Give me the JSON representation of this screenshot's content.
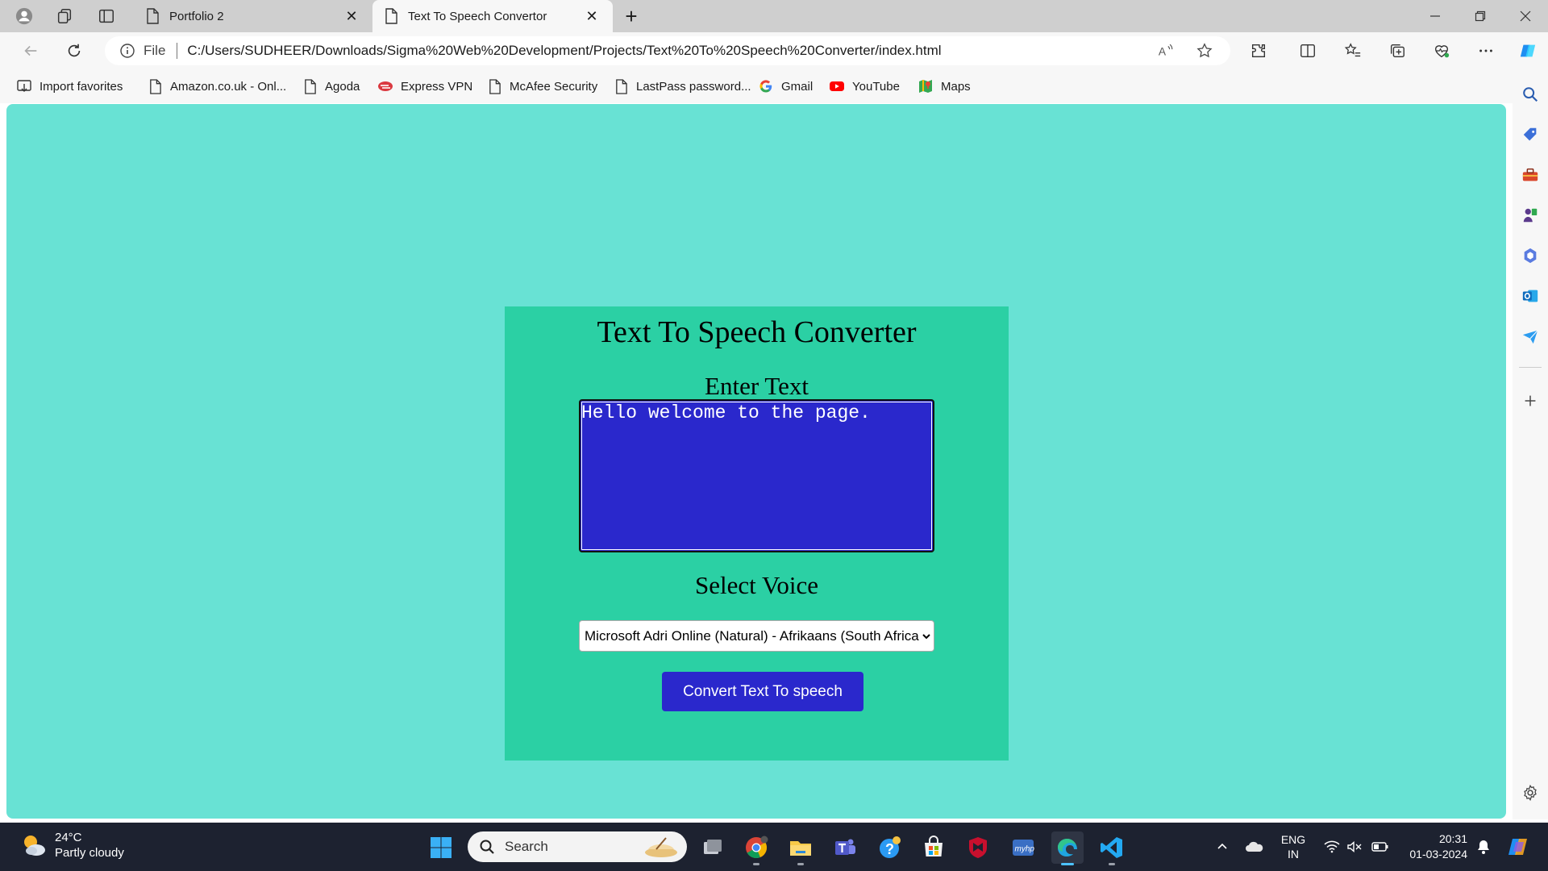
{
  "browser": {
    "tabs": [
      {
        "title": "Portfolio 2"
      },
      {
        "title": "Text To Speech Convertor"
      }
    ],
    "close_glyph": "✕",
    "newtab_glyph": "+",
    "address": {
      "scheme": "File",
      "url": "C:/Users/SUDHEER/Downloads/Sigma%20Web%20Development/Projects/Text%20To%20Speech%20Converter/index.html"
    },
    "favorites": [
      {
        "label": "Import favorites",
        "icon": "import-icon"
      },
      {
        "label": "Amazon.co.uk - Onl...",
        "icon": "page-icon"
      },
      {
        "label": "Agoda",
        "icon": "page-icon"
      },
      {
        "label": "Express VPN",
        "icon": "expressvpn-icon"
      },
      {
        "label": "McAfee Security",
        "icon": "page-icon"
      },
      {
        "label": "LastPass password...",
        "icon": "page-icon"
      },
      {
        "label": "Gmail",
        "icon": "google-icon"
      },
      {
        "label": "YouTube",
        "icon": "youtube-icon"
      },
      {
        "label": "Maps",
        "icon": "maps-icon"
      }
    ]
  },
  "app": {
    "title": "Text To Speech Converter",
    "enter_label": "Enter Text",
    "text_value": "Hello welcome to the page.",
    "voice_label": "Select Voice",
    "voice_selected": "Microsoft Adri Online (Natural) - Afrikaans (South Africa)",
    "convert_label": "Convert Text To speech"
  },
  "taskbar": {
    "weather": {
      "temp": "24°C",
      "condition": "Partly cloudy"
    },
    "search_placeholder": "Search",
    "lang": {
      "line1": "ENG",
      "line2": "IN"
    },
    "clock": {
      "time": "20:31",
      "date": "01-03-2024"
    }
  },
  "colors": {
    "page_bg": "#68e2d4",
    "card_bg": "#2bd0a4",
    "accent_blue": "#2a28cc"
  }
}
